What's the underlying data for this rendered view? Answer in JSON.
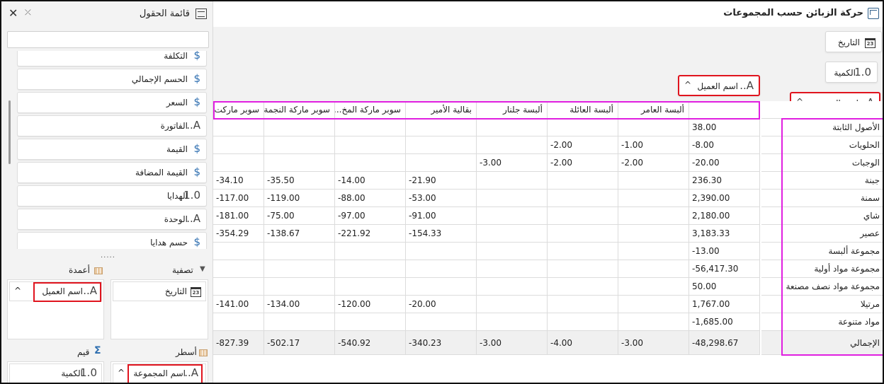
{
  "window": {
    "title": "حركة الزبائن حسب المجموعات"
  },
  "pivot": {
    "filter_chip": "التاريخ",
    "value_chip": "الكمية",
    "column_chip": "اسم العميل",
    "row_chip": "اسم المجموعة",
    "columns": [
      "",
      "ألبسة العامر",
      "ألبسة العائلة",
      "ألبسة جلنار",
      "بقالية الأمير",
      "سوبر ماركة المخ...",
      "سوبر ماركة النجمة",
      "سوبر ماركت"
    ],
    "rows": [
      {
        "label": "الأصول الثابتة",
        "values": [
          "38.00",
          "",
          "",
          "",
          "",
          "",
          "",
          ""
        ]
      },
      {
        "label": "الحلويات",
        "values": [
          "-8.00",
          "-1.00",
          "-2.00",
          "",
          "",
          "",
          "",
          ""
        ]
      },
      {
        "label": "الوجبات",
        "values": [
          "-20.00",
          "-2.00",
          "-2.00",
          "-3.00",
          "",
          "",
          "",
          ""
        ]
      },
      {
        "label": "جبنة",
        "values": [
          "236.30",
          "",
          "",
          "",
          "-21.90",
          "-14.00",
          "-35.50",
          "-34.10"
        ]
      },
      {
        "label": "سمنة",
        "values": [
          "2,390.00",
          "",
          "",
          "",
          "-53.00",
          "-88.00",
          "-119.00",
          "-117.00"
        ]
      },
      {
        "label": "شاي",
        "values": [
          "2,180.00",
          "",
          "",
          "",
          "-91.00",
          "-97.00",
          "-75.00",
          "-181.00"
        ]
      },
      {
        "label": "عصير",
        "values": [
          "3,183.33",
          "",
          "",
          "",
          "-154.33",
          "-221.92",
          "-138.67",
          "-354.29"
        ]
      },
      {
        "label": "مجموعة ألبسة",
        "values": [
          "-13.00",
          "",
          "",
          "",
          "",
          "",
          "",
          ""
        ]
      },
      {
        "label": "مجموعة مواد أولية",
        "values": [
          "-56,417.30",
          "",
          "",
          "",
          "",
          "",
          "",
          ""
        ]
      },
      {
        "label": "مجموعة مواد نصف مصنعة",
        "values": [
          "50.00",
          "",
          "",
          "",
          "",
          "",
          "",
          ""
        ]
      },
      {
        "label": "مرتيلا",
        "values": [
          "1,767.00",
          "",
          "",
          "",
          "-20.00",
          "-120.00",
          "-134.00",
          "-141.00"
        ]
      },
      {
        "label": "مواد متنوعة",
        "values": [
          "-1,685.00",
          "",
          "",
          "",
          "",
          "",
          "",
          ""
        ]
      }
    ],
    "total": {
      "label": "الإجمالي",
      "values": [
        "-48,298.67",
        "-3.00",
        "-4.00",
        "-3.00",
        "-340.23",
        "-540.92",
        "-502.17",
        "-827.39"
      ]
    }
  },
  "field_panel": {
    "title": "قائمة الحقول",
    "fields": [
      {
        "label": "التكلفة",
        "icon": "dollar-icon"
      },
      {
        "label": "الحسم الإجمالي",
        "icon": "dollar-icon"
      },
      {
        "label": "السعر",
        "icon": "dollar-icon"
      },
      {
        "label": "الفاتورة",
        "icon": "text-field-icon"
      },
      {
        "label": "القيمة",
        "icon": "dollar-icon"
      },
      {
        "label": "القيمة المضافة",
        "icon": "dollar-icon"
      },
      {
        "label": "الهدايا",
        "icon": "number-icon"
      },
      {
        "label": "الوحدة",
        "icon": "text-field-icon"
      },
      {
        "label": "حسم هدايا",
        "icon": "dollar-icon"
      }
    ],
    "areas": {
      "filter": {
        "title": "تصفية",
        "chip": "التاريخ"
      },
      "columns": {
        "title": "أعمدة",
        "chip": "اسم العميل"
      },
      "rows": {
        "title": "أسطر",
        "chip": "اسم المجموعة"
      },
      "values": {
        "title": "قيم",
        "chip": "الكمية"
      }
    }
  },
  "icons": {
    "dollar": "$",
    "text": "A..",
    "number": "1.0",
    "calendar": "23",
    "close": "✕",
    "sigma": "Σ",
    "filter": "▼",
    "caret_up": "^"
  },
  "colors": {
    "highlight_red": "#e0141e",
    "highlight_magenta": "#e01fe0",
    "accent_blue": "#2f6fb0"
  }
}
